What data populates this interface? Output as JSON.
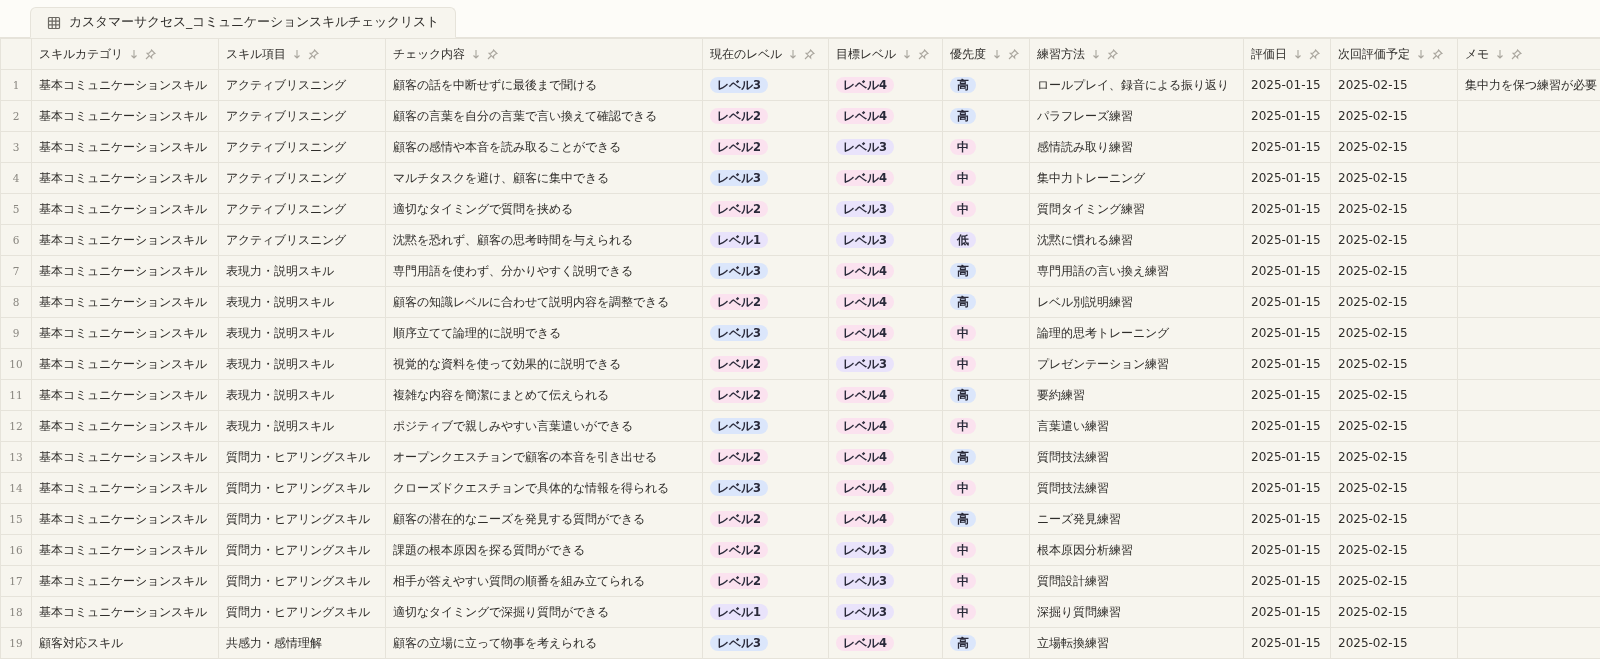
{
  "tab": {
    "title": "カスタマーサクセス_コミュニケーションスキルチェックリスト"
  },
  "columns": [
    "スキルカテゴリ",
    "スキル項目",
    "チェック内容",
    "現在のレベル",
    "目標レベル",
    "優先度",
    "練習方法",
    "評価日",
    "次回評価予定",
    "メモ"
  ],
  "rows": [
    {
      "number": "1",
      "category": "基本コミュニケーションスキル",
      "item": "アクティブリスニング",
      "check": "顧客の話を中断せずに最後まで聞ける",
      "current": {
        "text": "レベル3",
        "color": "#dbe6fb"
      },
      "target": {
        "text": "レベル4",
        "color": "#fbe2ef"
      },
      "priority": {
        "text": "高",
        "color": "#dbe6fb"
      },
      "method": "ロールプレイ、録音による振り返り",
      "eval_date": "2025-01-15",
      "next_date": "2025-02-15",
      "memo": "集中力を保つ練習が必要"
    },
    {
      "number": "2",
      "category": "基本コミュニケーションスキル",
      "item": "アクティブリスニング",
      "check": "顧客の言葉を自分の言葉で言い換えて確認できる",
      "current": {
        "text": "レベル2",
        "color": "#fbe2ef"
      },
      "target": {
        "text": "レベル4",
        "color": "#fbe2ef"
      },
      "priority": {
        "text": "高",
        "color": "#dbe6fb"
      },
      "method": "パラフレーズ練習",
      "eval_date": "2025-01-15",
      "next_date": "2025-02-15"
    },
    {
      "number": "3",
      "category": "基本コミュニケーションスキル",
      "item": "アクティブリスニング",
      "check": "顧客の感情や本音を読み取ることができる",
      "current": {
        "text": "レベル2",
        "color": "#fbe2ef"
      },
      "target": {
        "text": "レベル3",
        "color": "#e9e3fb"
      },
      "priority": {
        "text": "中",
        "color": "#fbe2ef"
      },
      "method": "感情読み取り練習",
      "eval_date": "2025-01-15",
      "next_date": "2025-02-15"
    },
    {
      "number": "4",
      "category": "基本コミュニケーションスキル",
      "item": "アクティブリスニング",
      "check": "マルチタスクを避け、顧客に集中できる",
      "current": {
        "text": "レベル3",
        "color": "#dbe6fb"
      },
      "target": {
        "text": "レベル4",
        "color": "#fbe2ef"
      },
      "priority": {
        "text": "中",
        "color": "#fbe2ef"
      },
      "method": "集中力トレーニング",
      "eval_date": "2025-01-15",
      "next_date": "2025-02-15"
    },
    {
      "number": "5",
      "category": "基本コミュニケーションスキル",
      "item": "アクティブリスニング",
      "check": "適切なタイミングで質問を挟める",
      "current": {
        "text": "レベル2",
        "color": "#fbe2ef"
      },
      "target": {
        "text": "レベル3",
        "color": "#e9e3fb"
      },
      "priority": {
        "text": "中",
        "color": "#fbe2ef"
      },
      "method": "質問タイミング練習",
      "eval_date": "2025-01-15",
      "next_date": "2025-02-15"
    },
    {
      "number": "6",
      "category": "基本コミュニケーションスキル",
      "item": "アクティブリスニング",
      "check": "沈黙を恐れず、顧客の思考時間を与えられる",
      "current": {
        "text": "レベル1",
        "color": "#e9e3fb"
      },
      "target": {
        "text": "レベル3",
        "color": "#e9e3fb"
      },
      "priority": {
        "text": "低",
        "color": "#e9e3fb"
      },
      "method": "沈黙に慣れる練習",
      "eval_date": "2025-01-15",
      "next_date": "2025-02-15"
    },
    {
      "number": "7",
      "category": "基本コミュニケーションスキル",
      "item": "表現力・説明スキル",
      "check": "専門用語を使わず、分かりやすく説明できる",
      "current": {
        "text": "レベル3",
        "color": "#dbe6fb"
      },
      "target": {
        "text": "レベル4",
        "color": "#fbe2ef"
      },
      "priority": {
        "text": "高",
        "color": "#dbe6fb"
      },
      "method": "専門用語の言い換え練習",
      "eval_date": "2025-01-15",
      "next_date": "2025-02-15"
    },
    {
      "number": "8",
      "category": "基本コミュニケーションスキル",
      "item": "表現力・説明スキル",
      "check": "顧客の知識レベルに合わせて説明内容を調整できる",
      "current": {
        "text": "レベル2",
        "color": "#fbe2ef"
      },
      "target": {
        "text": "レベル4",
        "color": "#fbe2ef"
      },
      "priority": {
        "text": "高",
        "color": "#dbe6fb"
      },
      "method": "レベル別説明練習",
      "eval_date": "2025-01-15",
      "next_date": "2025-02-15"
    },
    {
      "number": "9",
      "category": "基本コミュニケーションスキル",
      "item": "表現力・説明スキル",
      "check": "順序立てて論理的に説明できる",
      "current": {
        "text": "レベル3",
        "color": "#dbe6fb"
      },
      "target": {
        "text": "レベル4",
        "color": "#fbe2ef"
      },
      "priority": {
        "text": "中",
        "color": "#fbe2ef"
      },
      "method": "論理的思考トレーニング",
      "eval_date": "2025-01-15",
      "next_date": "2025-02-15"
    },
    {
      "number": "10",
      "category": "基本コミュニケーションスキル",
      "item": "表現力・説明スキル",
      "check": "視覚的な資料を使って効果的に説明できる",
      "current": {
        "text": "レベル2",
        "color": "#fbe2ef"
      },
      "target": {
        "text": "レベル3",
        "color": "#e9e3fb"
      },
      "priority": {
        "text": "中",
        "color": "#fbe2ef"
      },
      "method": "プレゼンテーション練習",
      "eval_date": "2025-01-15",
      "next_date": "2025-02-15"
    },
    {
      "number": "11",
      "category": "基本コミュニケーションスキル",
      "item": "表現力・説明スキル",
      "check": "複雑な内容を簡潔にまとめて伝えられる",
      "current": {
        "text": "レベル2",
        "color": "#fbe2ef"
      },
      "target": {
        "text": "レベル4",
        "color": "#fbe2ef"
      },
      "priority": {
        "text": "高",
        "color": "#dbe6fb"
      },
      "method": "要約練習",
      "eval_date": "2025-01-15",
      "next_date": "2025-02-15"
    },
    {
      "number": "12",
      "category": "基本コミュニケーションスキル",
      "item": "表現力・説明スキル",
      "check": "ポジティブで親しみやすい言葉遣いができる",
      "current": {
        "text": "レベル3",
        "color": "#dbe6fb"
      },
      "target": {
        "text": "レベル4",
        "color": "#fbe2ef"
      },
      "priority": {
        "text": "中",
        "color": "#fbe2ef"
      },
      "method": "言葉遣い練習",
      "eval_date": "2025-01-15",
      "next_date": "2025-02-15"
    },
    {
      "number": "13",
      "category": "基本コミュニケーションスキル",
      "item": "質問力・ヒアリングスキル",
      "check": "オープンクエスチョンで顧客の本音を引き出せる",
      "current": {
        "text": "レベル2",
        "color": "#fbe2ef"
      },
      "target": {
        "text": "レベル4",
        "color": "#fbe2ef"
      },
      "priority": {
        "text": "高",
        "color": "#dbe6fb"
      },
      "method": "質問技法練習",
      "eval_date": "2025-01-15",
      "next_date": "2025-02-15"
    },
    {
      "number": "14",
      "category": "基本コミュニケーションスキル",
      "item": "質問力・ヒアリングスキル",
      "check": "クローズドクエスチョンで具体的な情報を得られる",
      "current": {
        "text": "レベル3",
        "color": "#dbe6fb"
      },
      "target": {
        "text": "レベル4",
        "color": "#fbe2ef"
      },
      "priority": {
        "text": "中",
        "color": "#fbe2ef"
      },
      "method": "質問技法練習",
      "eval_date": "2025-01-15",
      "next_date": "2025-02-15"
    },
    {
      "number": "15",
      "category": "基本コミュニケーションスキル",
      "item": "質問力・ヒアリングスキル",
      "check": "顧客の潜在的なニーズを発見する質問ができる",
      "current": {
        "text": "レベル2",
        "color": "#fbe2ef"
      },
      "target": {
        "text": "レベル4",
        "color": "#fbe2ef"
      },
      "priority": {
        "text": "高",
        "color": "#dbe6fb"
      },
      "method": "ニーズ発見練習",
      "eval_date": "2025-01-15",
      "next_date": "2025-02-15"
    },
    {
      "number": "16",
      "category": "基本コミュニケーションスキル",
      "item": "質問力・ヒアリングスキル",
      "check": "課題の根本原因を探る質問ができる",
      "current": {
        "text": "レベル2",
        "color": "#fbe2ef"
      },
      "target": {
        "text": "レベル3",
        "color": "#e9e3fb"
      },
      "priority": {
        "text": "中",
        "color": "#fbe2ef"
      },
      "method": "根本原因分析練習",
      "eval_date": "2025-01-15",
      "next_date": "2025-02-15"
    },
    {
      "number": "17",
      "category": "基本コミュニケーションスキル",
      "item": "質問力・ヒアリングスキル",
      "check": "相手が答えやすい質問の順番を組み立てられる",
      "current": {
        "text": "レベル2",
        "color": "#fbe2ef"
      },
      "target": {
        "text": "レベル3",
        "color": "#e9e3fb"
      },
      "priority": {
        "text": "中",
        "color": "#fbe2ef"
      },
      "method": "質問設計練習",
      "eval_date": "2025-01-15",
      "next_date": "2025-02-15"
    },
    {
      "number": "18",
      "category": "基本コミュニケーションスキル",
      "item": "質問力・ヒアリングスキル",
      "check": "適切なタイミングで深掘り質問ができる",
      "current": {
        "text": "レベル1",
        "color": "#e9e3fb"
      },
      "target": {
        "text": "レベル3",
        "color": "#e9e3fb"
      },
      "priority": {
        "text": "中",
        "color": "#fbe2ef"
      },
      "method": "深掘り質問練習",
      "eval_date": "2025-01-15",
      "next_date": "2025-02-15"
    },
    {
      "number": "19",
      "category": "顧客対応スキル",
      "item": "共感力・感情理解",
      "check": "顧客の立場に立って物事を考えられる",
      "current": {
        "text": "レベル3",
        "color": "#dbe6fb"
      },
      "target": {
        "text": "レベル4",
        "color": "#fbe2ef"
      },
      "priority": {
        "text": "高",
        "color": "#dbe6fb"
      },
      "method": "立場転換練習",
      "eval_date": "2025-01-15",
      "next_date": "2025-02-15"
    }
  ]
}
